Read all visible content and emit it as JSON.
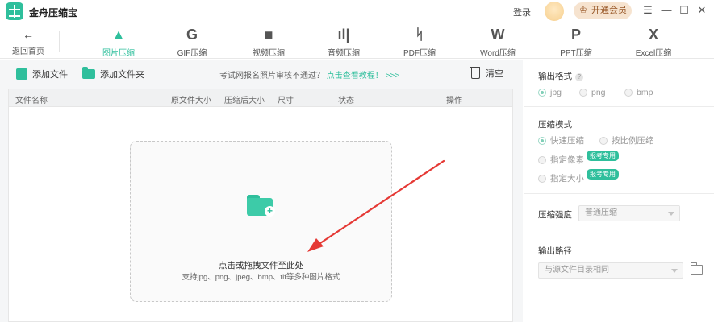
{
  "app": {
    "title": "金舟压缩宝"
  },
  "titlebar": {
    "login": "登录",
    "vip_button": "开通会员",
    "vip_icon": "crown-icon",
    "menu_icon": "☰",
    "minimize_icon": "—",
    "maximize_icon": "☐",
    "close_icon": "✕"
  },
  "nav": {
    "back_label": "返回首页",
    "back_icon": "←",
    "items": [
      {
        "label": "图片压缩",
        "icon": "▲",
        "icon_name": "image-compress-icon",
        "active": true
      },
      {
        "label": "GIF压缩",
        "icon": "G",
        "icon_name": "gif-compress-icon"
      },
      {
        "label": "视频压缩",
        "icon": "■",
        "icon_name": "video-compress-icon"
      },
      {
        "label": "音频压缩",
        "icon": "ıl|",
        "icon_name": "audio-compress-icon"
      },
      {
        "label": "PDF压缩",
        "icon": "ᛋ",
        "icon_name": "pdf-compress-icon"
      },
      {
        "label": "Word压缩",
        "icon": "W",
        "icon_name": "word-compress-icon"
      },
      {
        "label": "PPT压缩",
        "icon": "P",
        "icon_name": "ppt-compress-icon"
      },
      {
        "label": "Excel压缩",
        "icon": "X",
        "icon_name": "excel-compress-icon"
      }
    ]
  },
  "toolbar": {
    "add_file": "添加文件",
    "add_folder": "添加文件夹",
    "hint_text": "考试网报名照片审核不通过？",
    "hint_link": "点击查看教程！",
    "hint_arrows": ">>>",
    "clear": "清空"
  },
  "table": {
    "headers": [
      "文件名称",
      "原文件大小",
      "压缩后大小",
      "尺寸",
      "状态",
      "操作"
    ]
  },
  "dropzone": {
    "main": "点击或拖拽文件至此处",
    "sub": "支持jpg、png、jpeg、bmp、tif等多种图片格式"
  },
  "settings": {
    "output_format": {
      "title": "输出格式",
      "help": "?",
      "options": [
        "jpg",
        "png",
        "bmp"
      ],
      "selected": "jpg"
    },
    "compress_mode": {
      "title": "压缩模式",
      "options": [
        "快速压缩",
        "按比例压缩",
        "指定像素",
        "指定大小"
      ],
      "selected": "快速压缩",
      "vip_tag": "报考专用"
    },
    "strength": {
      "title": "压缩强度",
      "value": "普通压缩"
    },
    "output_path": {
      "title": "输出路径",
      "value": "与源文件目录相同"
    }
  },
  "colors": {
    "accent": "#2fbf9c",
    "arrow": "#e53935",
    "vip_bg": "#f6e3cf"
  }
}
